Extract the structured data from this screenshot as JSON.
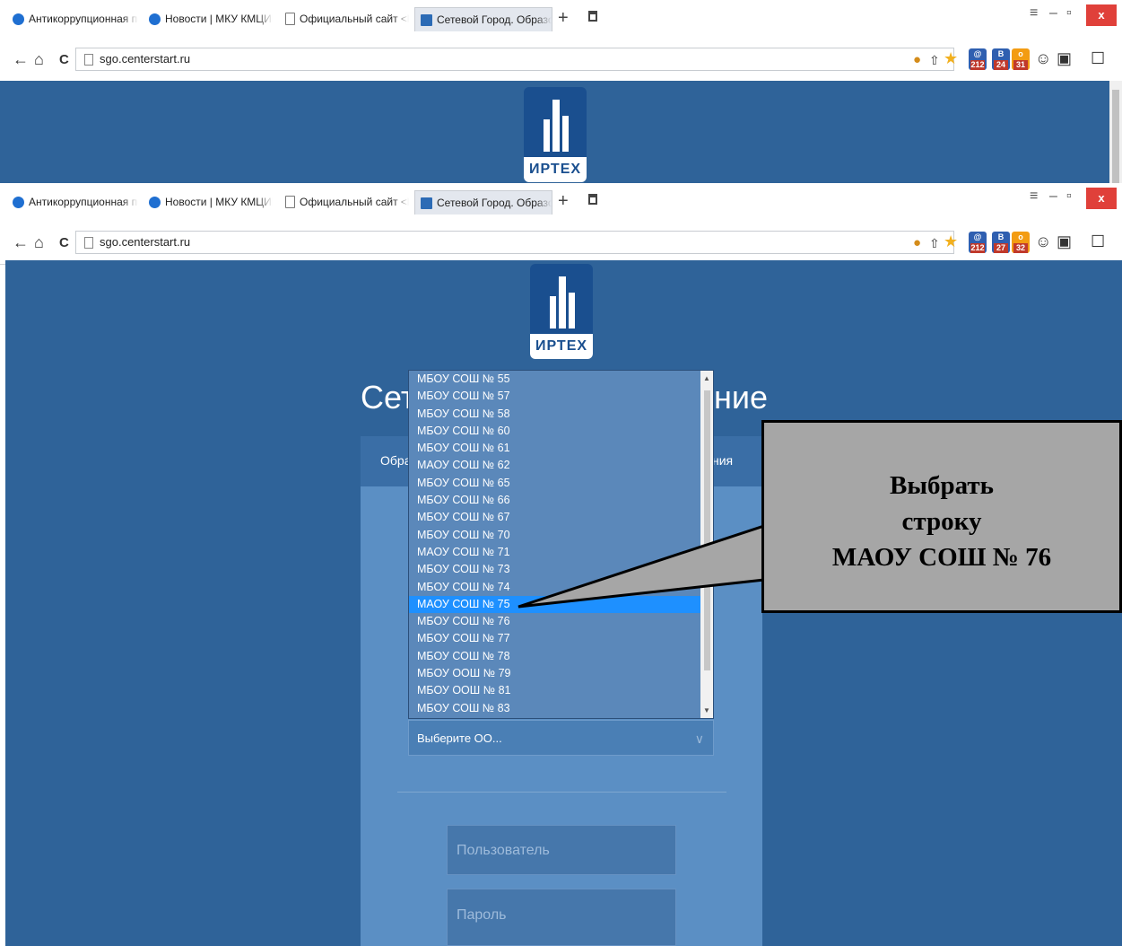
{
  "browser": {
    "tabs": [
      {
        "label": "Антикоррупционная полити",
        "icon": "globe-icon"
      },
      {
        "label": "Новости | МКУ КМЦИКТ \"СТ",
        "icon": "globe-icon"
      },
      {
        "label": "Официальный сайт <br> МБ",
        "icon": "document-icon"
      },
      {
        "label": "Сетевой Город. Образовани",
        "icon": "sgo-icon",
        "active": true
      }
    ],
    "url": "sgo.centerstart.ru",
    "extensions": [
      {
        "label": "212",
        "color": "#2f5fb0"
      },
      {
        "label": "24",
        "color": "#2f5fb0"
      },
      {
        "label": "31",
        "color": "#f39c12"
      }
    ],
    "extensions_bottom": [
      {
        "label": "212",
        "color": "#2f5fb0"
      },
      {
        "label": "27",
        "color": "#2f5fb0"
      },
      {
        "label": "32",
        "color": "#f39c12"
      }
    ],
    "close_label": "x"
  },
  "logo": {
    "text": "ИРТЕХ"
  },
  "login": {
    "title_left": "Сет",
    "title_right": "ние",
    "tab_left": "Обра",
    "tab_right": "ния",
    "school_select_placeholder": "Выберите ОО...",
    "username_placeholder": "Пользователь",
    "password_placeholder": "Пароль"
  },
  "dropdown": {
    "items": [
      "МБОУ СОШ № 55",
      "МБОУ СОШ № 57",
      "МБОУ СОШ № 58",
      "МБОУ СОШ № 60",
      "МБОУ СОШ № 61",
      "МАОУ СОШ № 62",
      "МБОУ СОШ № 65",
      "МБОУ СОШ № 66",
      "МБОУ СОШ № 67",
      "МБОУ СОШ № 70",
      "МАОУ СОШ № 71",
      "МБОУ СОШ № 73",
      "МБОУ СОШ № 74",
      "МАОУ СОШ № 75",
      "МБОУ СОШ № 76",
      "МБОУ СОШ № 77",
      "МБОУ СОШ № 78",
      "МБОУ ООШ № 79",
      "МБОУ ООШ № 81",
      "МБОУ СОШ № 83"
    ],
    "selected": "МАОУ СОШ № 75"
  },
  "callout": {
    "line1": "Выбрать",
    "line2": "строку",
    "line3": "МАОУ СОШ № 76"
  },
  "colors": {
    "page_bg": "#2f6399",
    "panel": "#5b8fc4",
    "highlight": "#1e90ff",
    "callout_bg": "#a6a6a6"
  }
}
